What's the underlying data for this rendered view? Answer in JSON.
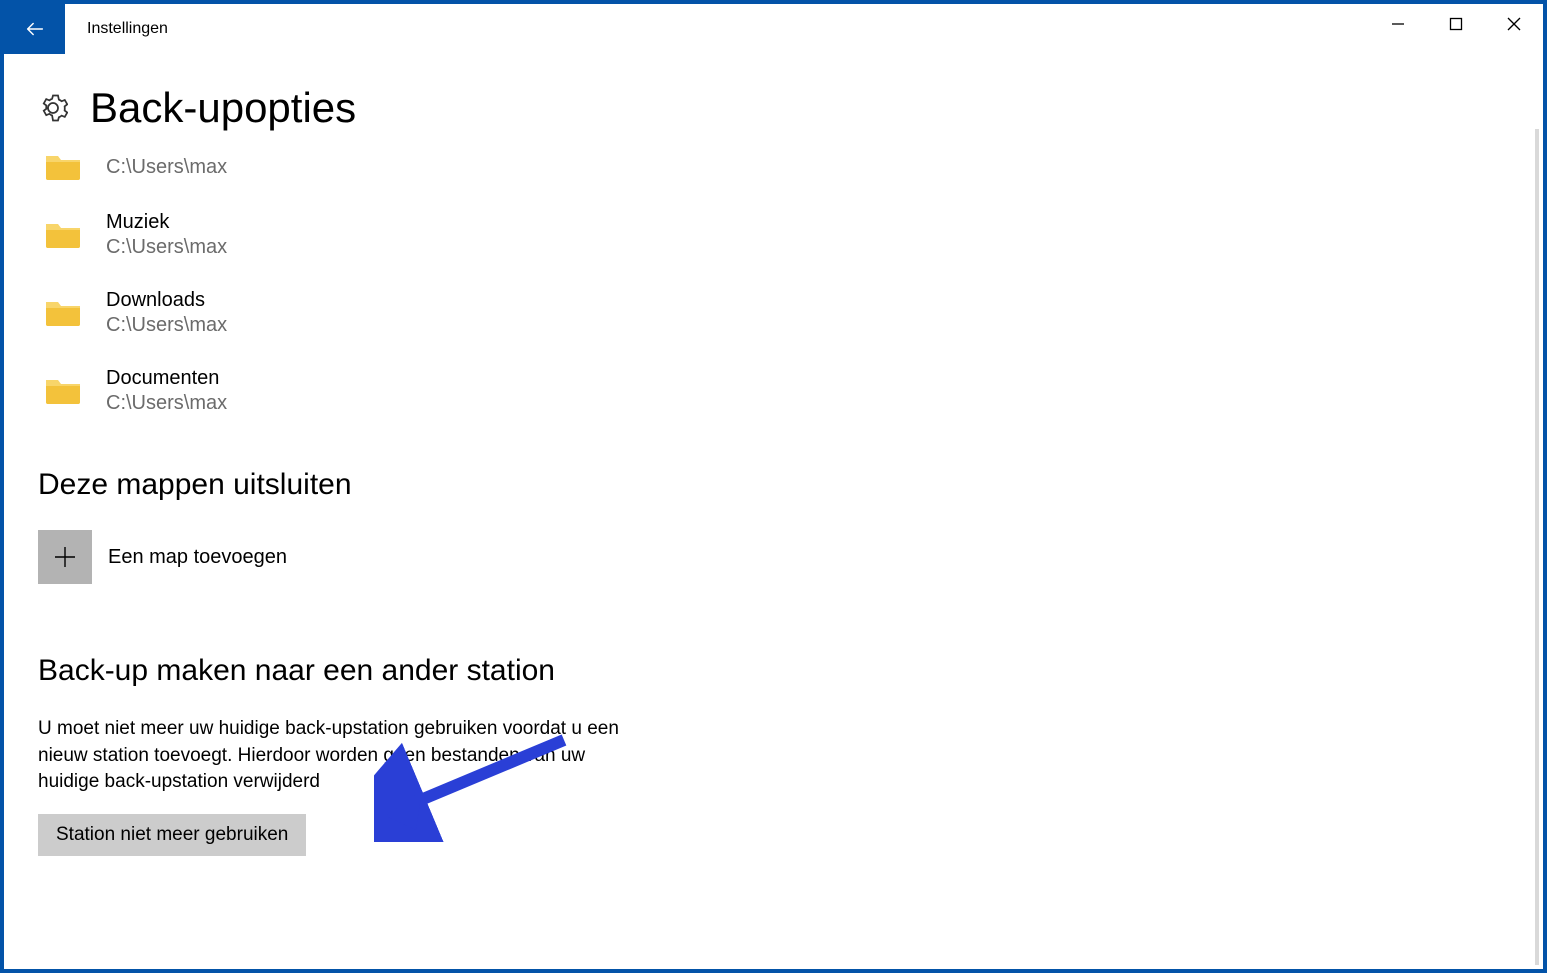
{
  "window": {
    "title": "Instellingen"
  },
  "page": {
    "heading": "Back-upopties"
  },
  "folders": [
    {
      "name": "",
      "path": "C:\\Users\\max"
    },
    {
      "name": "Muziek",
      "path": "C:\\Users\\max"
    },
    {
      "name": "Downloads",
      "path": "C:\\Users\\max"
    },
    {
      "name": "Documenten",
      "path": "C:\\Users\\max"
    }
  ],
  "exclude": {
    "heading": "Deze mappen uitsluiten",
    "add_label": "Een map toevoegen"
  },
  "other_drive": {
    "heading": "Back-up maken naar een ander station",
    "description": "U moet niet meer uw huidige back-upstation gebruiken voordat u een nieuw station toevoegt. Hierdoor worden geen bestanden van uw huidige back-upstation verwijderd",
    "button": "Station niet meer gebruiken"
  }
}
